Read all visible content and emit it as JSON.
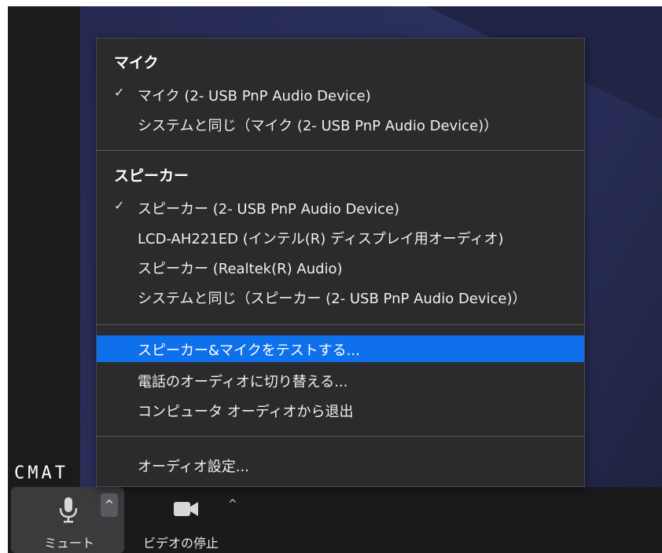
{
  "participant_name": "CMAT",
  "toolbar": {
    "mute_label": "ミュート",
    "video_label": "ビデオの停止",
    "caret": "^"
  },
  "menu": {
    "microphone": {
      "heading": "マイク",
      "items": [
        {
          "label": "マイク (2- USB PnP Audio Device)",
          "checked": true
        },
        {
          "label": "システムと同じ（マイク (2- USB PnP Audio Device)）",
          "checked": false
        }
      ]
    },
    "speaker": {
      "heading": "スピーカー",
      "items": [
        {
          "label": "スピーカー (2- USB PnP Audio Device)",
          "checked": true
        },
        {
          "label": "LCD-AH221ED (インテル(R) ディスプレイ用オーディオ)",
          "checked": false
        },
        {
          "label": "スピーカー (Realtek(R) Audio)",
          "checked": false
        },
        {
          "label": "システムと同じ（スピーカー (2- USB PnP Audio Device)）",
          "checked": false
        }
      ]
    },
    "actions": [
      {
        "label": "スピーカー&マイクをテストする...",
        "highlighted": true
      },
      {
        "label": "電話のオーディオに切り替える...",
        "highlighted": false
      },
      {
        "label": "コンピュータ オーディオから退出",
        "highlighted": false
      }
    ],
    "settings_label": "オーディオ設定...",
    "check_glyph": "✓"
  },
  "colors": {
    "menu_bg": "#2b2b2e",
    "highlight": "#0e71eb",
    "toolbar_bg": "#1a1a1c"
  },
  "icons": {
    "mute": "microphone-icon",
    "video": "video-camera-icon",
    "check": "check-icon",
    "caret": "caret-up-icon"
  }
}
